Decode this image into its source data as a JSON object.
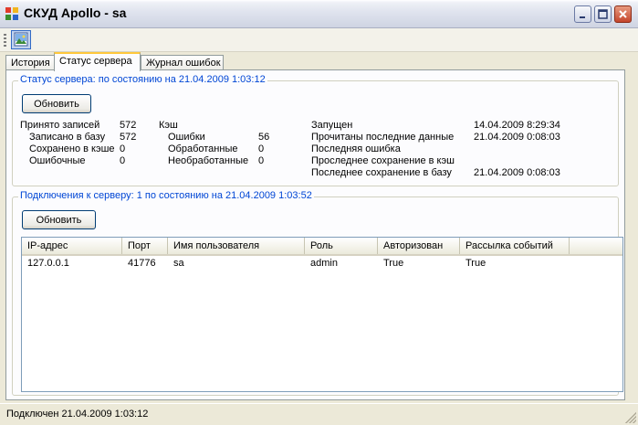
{
  "window": {
    "title": "СКУД Apollo - sa"
  },
  "tabs": [
    {
      "label": "История"
    },
    {
      "label": "Статус сервера"
    },
    {
      "label": "Журнал ошибок"
    }
  ],
  "server_status": {
    "legend": "Статус сервера: по состоянию на 21.04.2009 1:03:12",
    "refresh_label": "Обновить",
    "received_label": "Принято записей",
    "received_value": "572",
    "written_label": "Записано в базу",
    "written_value": "572",
    "saved_cache_label": "Сохранено в кэше",
    "saved_cache_value": "0",
    "erroneous_label": "Ошибочные",
    "erroneous_value": "0",
    "cache_label": "Кэш",
    "errors_label": "Ошибки",
    "errors_value": "56",
    "processed_label": "Обработанные",
    "processed_value": "0",
    "unprocessed_label": "Необработанные",
    "unprocessed_value": "0",
    "started_label": "Запущен",
    "started_value": "14.04.2009 8:29:34",
    "last_read_label": "Прочитаны последние данные",
    "last_read_value": "21.04.2009 0:08:03",
    "last_error_label": "Последняя ошибка",
    "last_error_value": "",
    "last_cache_save_label": "Проследнее сохранение в кэш",
    "last_cache_save_value": "",
    "last_db_save_label": "Последнее сохранение в базу",
    "last_db_save_value": "21.04.2009 0:08:03"
  },
  "connections": {
    "legend": "Подключения к серверу: 1 по состоянию на 21.04.2009 1:03:52",
    "refresh_label": "Обновить",
    "columns": [
      "IP-адрес",
      "Порт",
      "Имя пользователя",
      "Роль",
      "Авторизован",
      "Рассылка событий"
    ],
    "rows": [
      [
        "127.0.0.1",
        "41776",
        "sa",
        "admin",
        "True",
        "True"
      ]
    ]
  },
  "statusbar": {
    "text": "Подключен 21.04.2009 1:03:12"
  },
  "icons": {
    "app": "app-icon",
    "toolbar_button": "image-icon",
    "minimize": "minimize-icon",
    "maximize": "maximize-icon",
    "close": "close-icon"
  }
}
